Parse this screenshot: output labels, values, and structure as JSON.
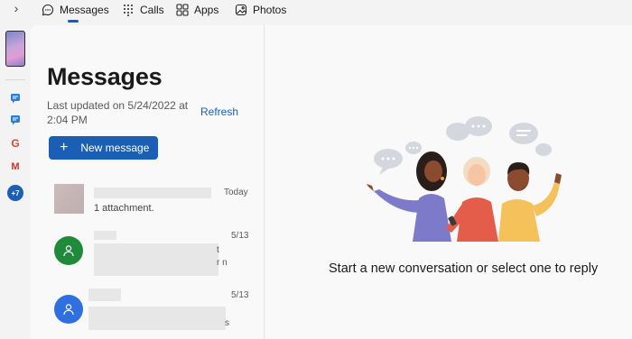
{
  "topbar": {
    "expand_glyph": "›",
    "tabs": [
      {
        "label": "Messages",
        "icon": "chat-bubble-icon",
        "active": true
      },
      {
        "label": "Calls",
        "icon": "keypad-icon",
        "active": false
      },
      {
        "label": "Apps",
        "icon": "apps-grid-icon",
        "active": false
      },
      {
        "label": "Photos",
        "icon": "photos-icon",
        "active": false
      }
    ]
  },
  "rail": {
    "apps": [
      "messaging-app-icon",
      "messaging-app-icon-2",
      "google-app-icon",
      "gmail-app-icon"
    ],
    "google_glyph": "G",
    "gmail_glyph": "M",
    "more_label": "+7"
  },
  "list": {
    "title": "Messages",
    "last_updated": "Last updated on 5/24/2022 at 2:04 PM",
    "refresh_label": "Refresh",
    "new_message_label": "New message",
    "new_message_icon": "plus-icon",
    "conversations": [
      {
        "date": "Today",
        "preview": "1 attachment.",
        "avatar": "image-thumbnail"
      },
      {
        "date": "5/13",
        "preview": "",
        "avatar": "person-icon",
        "avatar_color": "#1e8a3a",
        "edge_chars": [
          "t",
          "r n"
        ]
      },
      {
        "date": "5/13",
        "preview": "",
        "avatar": "person-icon",
        "avatar_color": "#2f6fe0",
        "edge_chars": [
          "s"
        ]
      }
    ]
  },
  "main": {
    "empty_state": "Start a new conversation or select one to reply",
    "illustration": "people-chatting-illustration"
  },
  "colors": {
    "accent": "#1a5fb4",
    "background": "#f3f3f3",
    "pane": "#f9f9f9"
  }
}
